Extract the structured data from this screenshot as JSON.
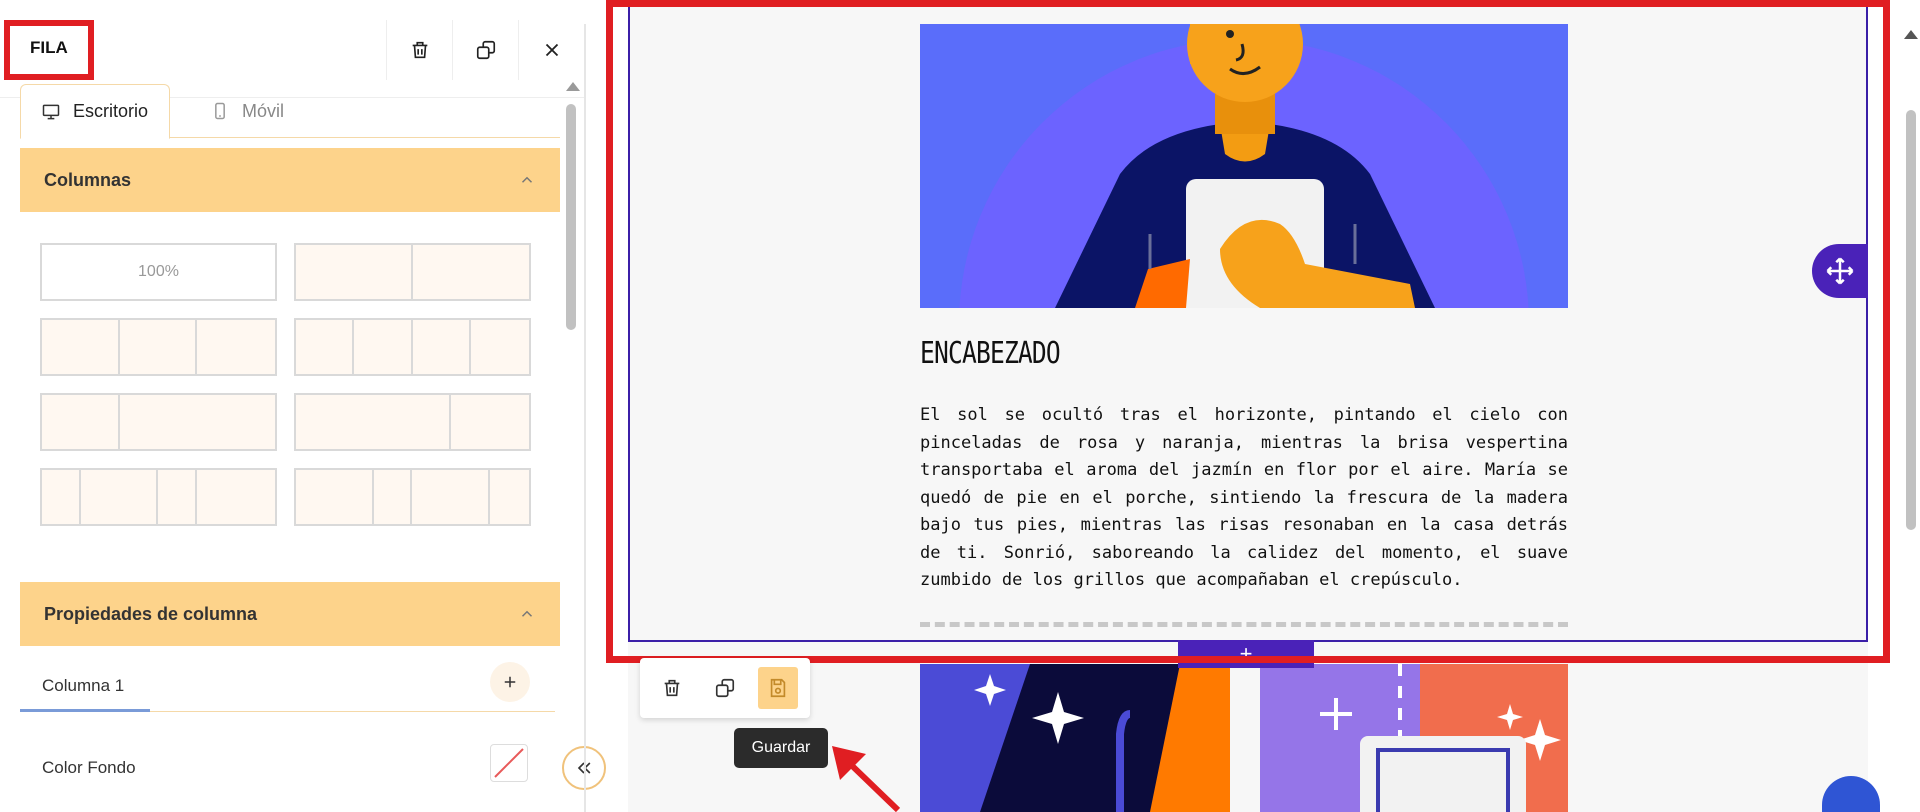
{
  "panel": {
    "title": "FILA",
    "tabs": [
      {
        "label": "Escritorio",
        "icon": "desktop-icon",
        "active": true
      },
      {
        "label": "Móvil",
        "icon": "mobile-icon",
        "active": false
      }
    ],
    "columns_section": {
      "title": "Columnas",
      "layouts": [
        {
          "label": "100%",
          "cells": [
            1
          ]
        },
        {
          "label": "",
          "cells": [
            1,
            1
          ]
        },
        {
          "label": "",
          "cells": [
            1,
            1,
            1
          ]
        },
        {
          "label": "",
          "cells": [
            1,
            1,
            1,
            1
          ]
        },
        {
          "label": "",
          "cells": [
            1,
            2
          ]
        },
        {
          "label": "",
          "cells": [
            2,
            1
          ]
        },
        {
          "label": "",
          "cells": [
            1,
            2,
            1,
            2
          ]
        },
        {
          "label": "",
          "cells": [
            2,
            1,
            2,
            1
          ]
        }
      ]
    },
    "column_props_section": {
      "title": "Propiedades de columna",
      "column_tab": "Columna 1",
      "background_label": "Color Fondo"
    }
  },
  "canvas": {
    "heading": "ENCABEZADO",
    "paragraph": "El sol se ocultó tras el horizonte, pintando el cielo con pinceladas de rosa y naranja, mientras la brisa vespertina transportaba el aroma del jazmín en flor por el aire. María se quedó de pie en el porche, sintiendo la frescura de la madera bajo tus pies, mientras las risas resonaban en la casa detrás de ti. Sonrió, saboreando la calidez del momento, el suave zumbido de los grillos que acompañaban el crepúsculo.",
    "add_row_symbol": "+",
    "tooltip": "Guardar"
  },
  "colors": {
    "accent": "#fdd38b",
    "row_outline": "#3b1fa8",
    "handle": "#4a22b8",
    "highlight": "#e01e22"
  }
}
